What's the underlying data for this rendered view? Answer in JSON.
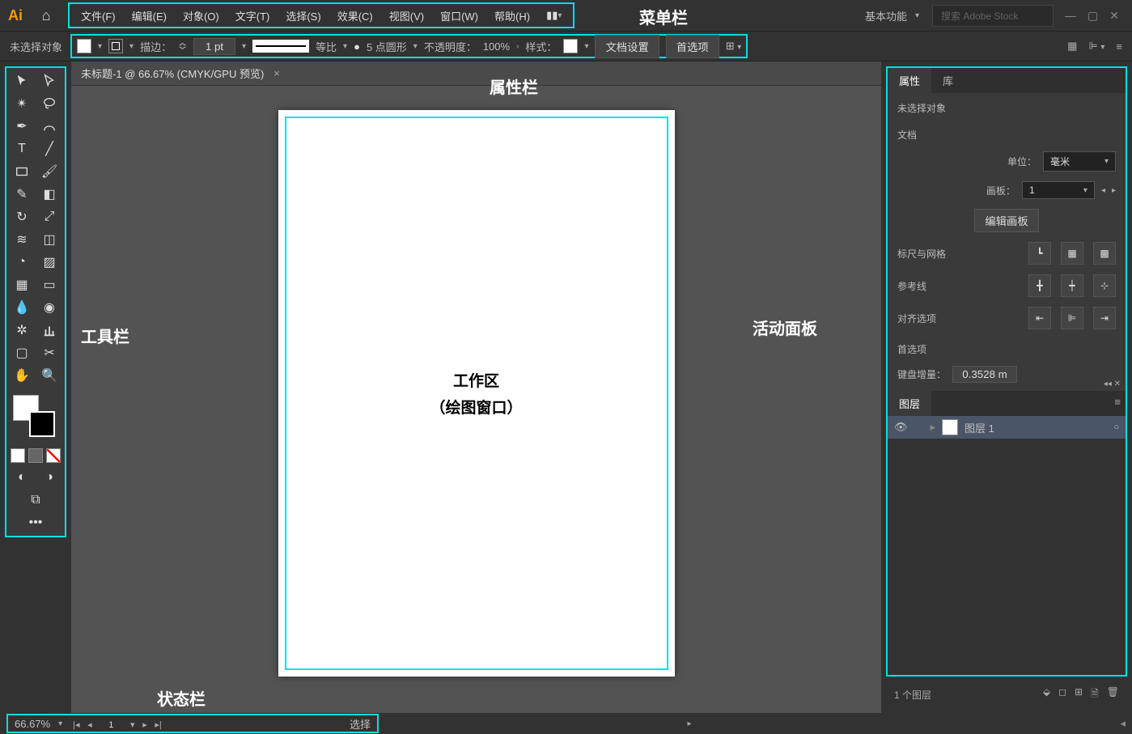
{
  "annotations": {
    "menubar": "菜单栏",
    "propsbar": "属性栏",
    "toolbox": "工具栏",
    "panels": "活动面板",
    "workarea1": "工作区",
    "workarea2": "（绘图窗口）",
    "statusbar": "状态栏"
  },
  "menubar": {
    "logo": "Ai",
    "items": [
      "文件(F)",
      "编辑(E)",
      "对象(O)",
      "文字(T)",
      "选择(S)",
      "效果(C)",
      "视图(V)",
      "窗口(W)",
      "帮助(H)"
    ],
    "workspace": "基本功能",
    "search_placeholder": "搜索 Adobe Stock"
  },
  "controlbar": {
    "no_selection": "未选择对象",
    "stroke_label": "描边：",
    "stroke_val": "1 pt",
    "profile_label": "等比",
    "brush_val": "5 点圆形",
    "opacity_label": "不透明度：",
    "opacity_val": "100%",
    "style_label": "样式：",
    "doc_setup": "文档设置",
    "prefs": "首选项"
  },
  "doc": {
    "tab_title": "未标题-1 @ 66.67% (CMYK/GPU 预览)"
  },
  "properties": {
    "tab_props": "属性",
    "tab_lib": "库",
    "no_selection": "未选择对象",
    "doc_section": "文档",
    "unit_label": "单位：",
    "unit_val": "毫米",
    "artboard_label": "画板：",
    "artboard_val": "1",
    "edit_artboard": "编辑画板",
    "ruler_grid": "标尺与网格",
    "guides": "参考线",
    "align": "对齐选项",
    "prefs": "首选项",
    "kbd_inc_label": "键盘增量：",
    "kbd_inc_val": "0.3528 m"
  },
  "layers": {
    "tab": "图层",
    "layer1": "图层 1",
    "footer": "1 个图层"
  },
  "statusbar": {
    "zoom": "66.67%",
    "artboard": "1",
    "tool": "选择"
  }
}
